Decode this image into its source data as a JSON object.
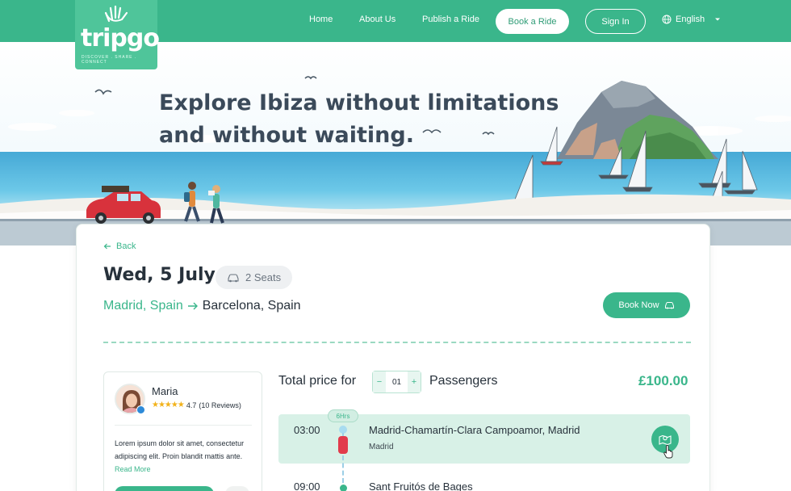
{
  "brand": {
    "name": "tripgo",
    "tagline": "DISCOVER . SHARE . CONNECT"
  },
  "nav": {
    "home": "Home",
    "about": "About Us",
    "publish": "Publish a Ride",
    "book_ride": "Book a Ride",
    "sign_in": "Sign In",
    "language": "English"
  },
  "hero": {
    "title_line1": "Explore Ibiza without limitations",
    "title_line2": "and without waiting."
  },
  "ride": {
    "back": "Back",
    "date": "Wed, 5 July",
    "seats": "2 Seats",
    "from": "Madrid, Spain",
    "to": "Barcelona, Spain",
    "book_now": "Book Now"
  },
  "driver": {
    "name": "Maria",
    "rating": "4.7",
    "reviews": "(10 Reviews)",
    "stars": 4.5,
    "bio": "Lorem ipsum dolor sit amet, consectetur adipiscing elit. Proin blandit mattis ante.",
    "read_more": "Read More"
  },
  "pricing": {
    "total_label": "Total price for",
    "passengers_count": "01",
    "passengers_label": "Passengers",
    "price": "£100.00",
    "minus": "−",
    "plus": "+"
  },
  "itinerary": {
    "duration": "6Hrs",
    "stops": [
      {
        "time": "03:00",
        "title": "Madrid-Chamartín-Clara Campoamor, Madrid",
        "subtitle": "Madrid"
      },
      {
        "time": "09:00",
        "title": "Sant Fruitós de Bages",
        "subtitle": ""
      }
    ]
  },
  "colors": {
    "primary": "#3ab68b",
    "heading": "#3b4a5a",
    "text": "#27313b",
    "highlight_row": "#d8f1e7"
  }
}
